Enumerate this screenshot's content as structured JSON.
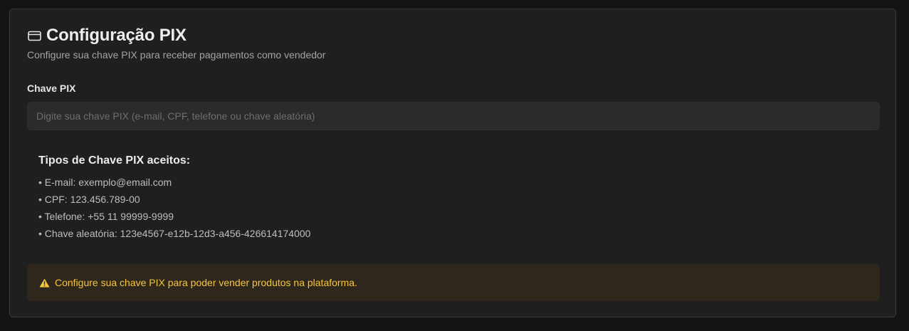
{
  "header": {
    "title": "Configuração PIX",
    "subtitle": "Configure sua chave PIX para receber pagamentos como vendedor",
    "icon": "credit-card-icon"
  },
  "form": {
    "label": "Chave PIX",
    "value": "",
    "placeholder": "Digite sua chave PIX (e-mail, CPF, telefone ou chave aleatória)"
  },
  "key_types": {
    "heading": "Tipos de Chave PIX aceitos:",
    "items": [
      "• E-mail: exemplo@email.com",
      "• CPF: 123.456.789-00",
      "• Telefone: +55 11 99999-9999",
      "• Chave aleatória: 123e4567-e12b-12d3-a456-426614174000"
    ]
  },
  "warning": {
    "icon": "warning-triangle-icon",
    "text": "Configure sua chave PIX para poder vender produtos na plataforma.",
    "color": "#f5c63b"
  },
  "colors": {
    "background": "#141414",
    "card": "#1f1f1f",
    "input_bg": "#2b2b2b",
    "warning_bg": "#2f261c",
    "accent_warning": "#f5c63b"
  }
}
